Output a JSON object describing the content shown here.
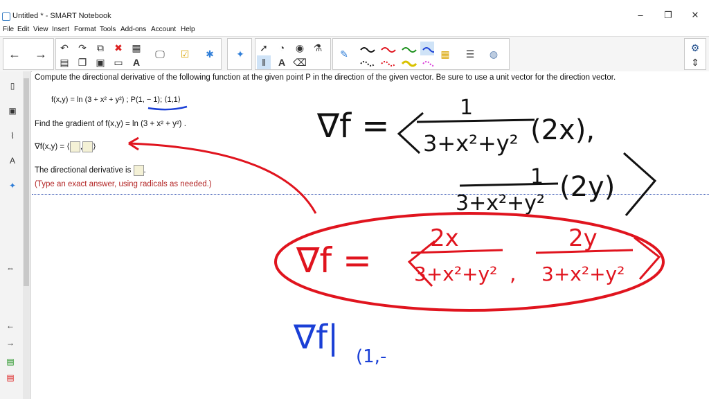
{
  "window": {
    "title": "Untitled * - SMART Notebook",
    "controls": [
      "–",
      "❐",
      "✕"
    ]
  },
  "menu": [
    "File",
    "Edit",
    "View",
    "Insert",
    "Format",
    "Tools",
    "Add-ons",
    "Account",
    "Help"
  ],
  "toolbar": {
    "icons": [
      "back-arrow-icon",
      "forward-arrow-icon",
      "undo-icon",
      "redo-icon",
      "paste-icon",
      "delete-icon",
      "table-icon",
      "screen-share-icon",
      "check-box-icon",
      "add-on-icon",
      "puzzle-icon",
      "select-icon",
      "shape-icon",
      "fill-icon",
      "eraser-icon",
      "pen-icon",
      "line-icon",
      "color-icon",
      "magic-pen-icon",
      "settings-icon"
    ],
    "glyph_select": "A",
    "accent": "#2f7ed8"
  },
  "question": {
    "prompt": "Compute the directional derivative of the following function at the given point P in the direction of the given vector. Be sure to use a unit vector for the direction vector.",
    "function_line": "f(x,y) = ln (3 + x² + y²) ; P(1, − 1);  ⟨1,1⟩",
    "gradient_prompt": "Find the gradient of f(x,y) = ln (3 + x² + y²) .",
    "gradient_label": "∇f(x,y) = ",
    "gradient_left": "⟨",
    "gradient_sep": ",",
    "gradient_right": "⟩",
    "dir_prompt": "The directional derivative is",
    "dir_end": ".",
    "hint": "(Type an exact answer, using radicals as needed.)",
    "hint_color": "#b22222"
  },
  "ink": {
    "black_grad_1": "∇f = ",
    "black_frac_num": "1",
    "black_frac_den": "3+x²+y²",
    "black_2x": "(2x),",
    "black_2y": "(2y)",
    "red_grad": "∇f = ",
    "red_num_1": "2x",
    "red_num_2": "2y",
    "red_den": "3+x²+y²",
    "blue_eval": "∇f|",
    "blue_sub": "(1,-",
    "colors": {
      "black": "#111111",
      "red": "#e0141e",
      "blue": "#1a3fd6"
    }
  }
}
